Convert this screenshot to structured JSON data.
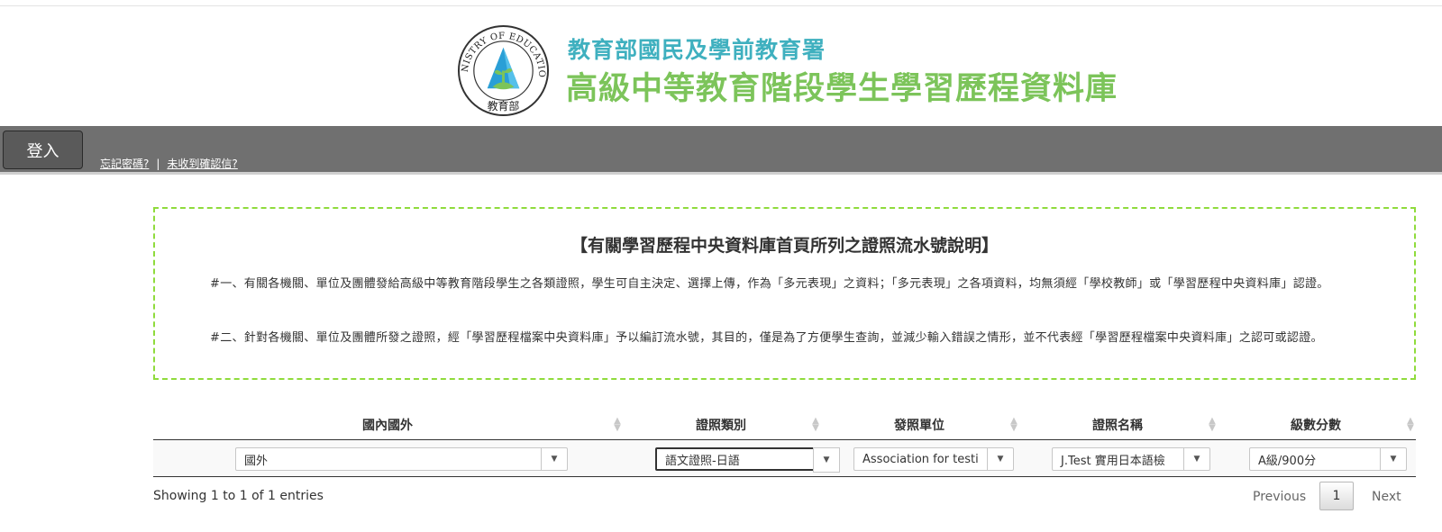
{
  "header": {
    "logo_text": "MINISTRY OF EDUCATION 教育部",
    "org_title": "教育部國民及學前教育署",
    "site_title": "高級中等教育階段學生學習歷程資料庫"
  },
  "nav": {
    "login_label": "登入",
    "forgot_password": "忘記密碼?",
    "separator": "|",
    "no_confirmation": "未收到確認信?"
  },
  "notice": {
    "title": "【有關學習歷程中央資料庫首頁所列之證照流水號說明】",
    "paragraphs": [
      "#一、有關各機關、單位及團體發給高級中等教育階段學生之各類證照，學生可自主決定、選擇上傳，作為「多元表現」之資料；「多元表現」之各項資料，均無須經「學校教師」或「學習歷程中央資料庫」認證。",
      "#二、針對各機關、單位及團體所發之證照，經「學習歷程檔案中央資料庫」予以編訂流水號，其目的，僅是為了方便學生查詢，並減少輸入錯誤之情形，並不代表經「學習歷程檔案中央資料庫」之認可或認證。"
    ]
  },
  "table": {
    "columns": [
      "國內國外",
      "證照類別",
      "發照單位",
      "證照名稱",
      "級數分數"
    ],
    "rows": [
      [
        "國外",
        "語文證照-日語",
        "Association for testi",
        "J.Test 實用日本語檢",
        "A級/900分"
      ]
    ]
  },
  "footer": {
    "info": "Showing 1 to 1 of 1 entries",
    "previous": "Previous",
    "page": "1",
    "next": "Next"
  },
  "colors": {
    "org_title": "#3fb0bf",
    "site_title": "#7cc45a",
    "navbar": "#707070",
    "notice_border": "#8fdb3c"
  }
}
